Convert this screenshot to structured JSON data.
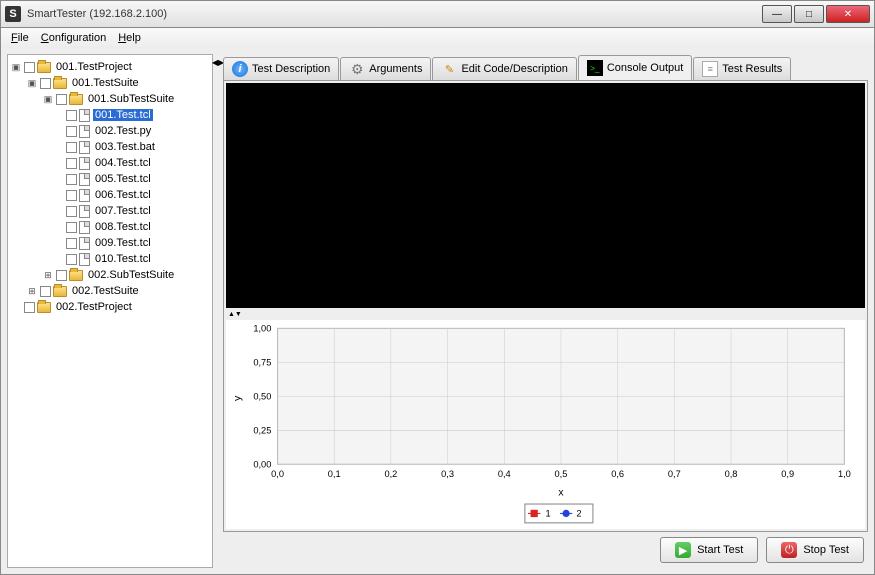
{
  "window": {
    "title": "SmartTester (192.168.2.100)",
    "icon_glyph": "S"
  },
  "menu": {
    "file": "File",
    "config": "Configuration",
    "help": "Help"
  },
  "tree": {
    "root": {
      "label": "001.TestProject"
    },
    "suite1": {
      "label": "001.TestSuite"
    },
    "sub1": {
      "label": "001.SubTestSuite"
    },
    "tests": [
      "001.Test.tcl",
      "002.Test.py",
      "003.Test.bat",
      "004.Test.tcl",
      "005.Test.tcl",
      "006.Test.tcl",
      "007.Test.tcl",
      "008.Test.tcl",
      "009.Test.tcl",
      "010.Test.tcl"
    ],
    "sub2": {
      "label": "002.SubTestSuite"
    },
    "suite2": {
      "label": "002.TestSuite"
    },
    "proj2": {
      "label": "002.TestProject"
    }
  },
  "tabs": {
    "desc": "Test Description",
    "args": "Arguments",
    "edit": "Edit Code/Description",
    "console": "Console Output",
    "results": "Test Results"
  },
  "buttons": {
    "start": "Start Test",
    "stop": "Stop Test"
  },
  "chart_data": {
    "type": "line",
    "title": "",
    "xlabel": "x",
    "ylabel": "y",
    "xlim": [
      0.0,
      1.0
    ],
    "ylim": [
      0.0,
      1.0
    ],
    "xticks": [
      "0,0",
      "0,1",
      "0,2",
      "0,3",
      "0,4",
      "0,5",
      "0,6",
      "0,7",
      "0,8",
      "0,9",
      "1,0"
    ],
    "yticks": [
      "0,00",
      "0,25",
      "0,50",
      "0,75",
      "1,00"
    ],
    "series": [
      {
        "name": "1",
        "color": "#d22",
        "marker": "square",
        "values": []
      },
      {
        "name": "2",
        "color": "#24d",
        "marker": "circle",
        "values": []
      }
    ],
    "legend_position": "bottom"
  }
}
